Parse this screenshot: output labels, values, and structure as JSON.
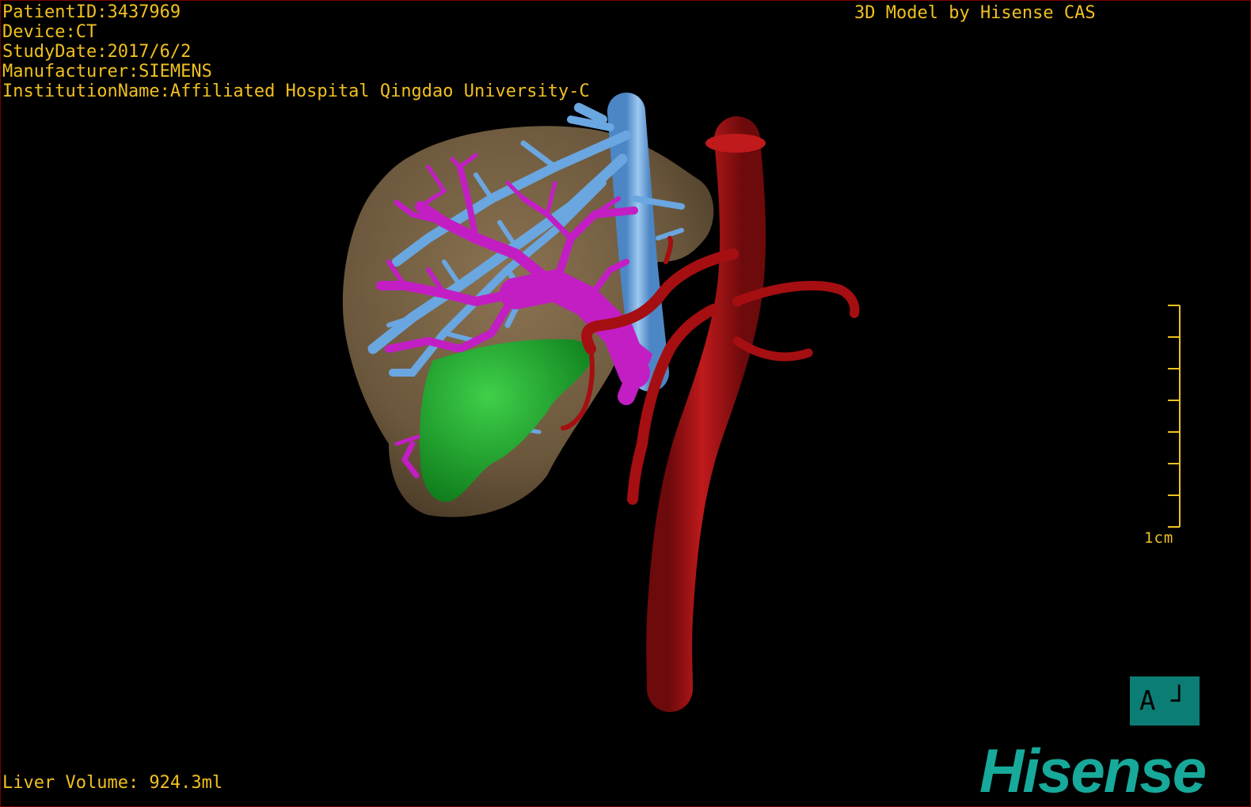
{
  "header": {
    "patient_id": "PatientID:3437969",
    "device": "Device:CT",
    "study_date": "StudyDate:2017/6/2",
    "manufacturer": "Manufacturer:SIEMENS",
    "institution": "InstitutionName:Affiliated Hospital Qingdao University-C",
    "model_title": "3D Model by Hisense CAS"
  },
  "footer": {
    "liver_volume": "Liver Volume: 924.3ml",
    "brand": "Hisense"
  },
  "scale_bar": {
    "label": "1cm"
  },
  "orientation": {
    "letter": "A",
    "corner_glyph": "┘"
  },
  "colors": {
    "text": "#f0c020",
    "liver": "#7a6446",
    "portal_vein": "#c21ec4",
    "hepatic_vein": "#6aa6e0",
    "aorta": "#a50f12",
    "gallbladder_segment": "#19a82a",
    "brand": "#17a99a",
    "orientation_box": "#0c7d74",
    "border": "#7a0000"
  },
  "icons": {
    "orientation": "orientation-cube-icon"
  }
}
